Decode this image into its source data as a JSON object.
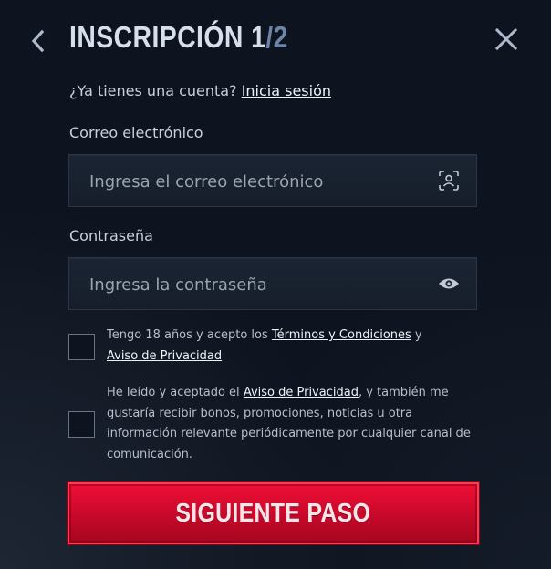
{
  "header": {
    "title_main": "INSCRIPCIÓN 1",
    "title_separator": "/",
    "title_total": "2",
    "back_icon": "chevron-left-icon",
    "close_icon": "close-icon"
  },
  "login_prompt": {
    "text": "¿Ya tienes una cuenta?",
    "link": "Inicia sesión"
  },
  "email": {
    "label": "Correo electrónico",
    "placeholder": "Ingresa el correo electrónico",
    "value": "",
    "icon": "face-scan-icon"
  },
  "password": {
    "label": "Contraseña",
    "placeholder": "Ingresa la contraseña",
    "value": "",
    "icon": "eye-icon"
  },
  "terms": {
    "checked": false,
    "text_1": "Tengo 18 años y acepto los ",
    "link_terms": "Términos y Condiciones",
    "text_2": " y",
    "link_privacy": "Aviso de Privacidad"
  },
  "marketing": {
    "checked": false,
    "text_1": "He leído y aceptado el ",
    "link_privacy": "Aviso de Privacidad",
    "text_2": ", y también me gustaría recibir bonos, promociones, noticias u otra información relevante periódicamente por cualquier canal de comunicación."
  },
  "submit": {
    "label": "SIGUIENTE PASO"
  },
  "colors": {
    "background": "#0e141f",
    "accent": "#e10c33",
    "muted_accent": "#6d84a8"
  }
}
